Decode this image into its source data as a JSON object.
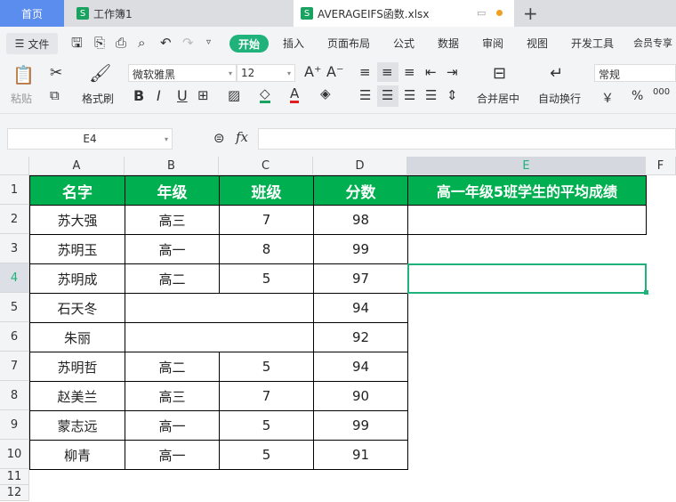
{
  "tabs": [
    {
      "label": "首页",
      "active": false
    },
    {
      "label": "工作簿1"
    },
    {
      "label": "AVERAGEIFS函数.xlsx"
    }
  ],
  "new_tab": "+",
  "menu": {
    "file": "文件",
    "items": [
      "开始",
      "插入",
      "页面布局",
      "公式",
      "数据",
      "审阅",
      "视图",
      "开发工具",
      "会员专享"
    ]
  },
  "ribbon": {
    "paste": "粘贴",
    "format_painter": "格式刷",
    "font": "微软雅黑",
    "size": "12",
    "merge": "合并居中",
    "wrap": "自动换行",
    "number_format": "常规",
    "currency": "￥",
    "percent": "%",
    "thousands": "000"
  },
  "formula_bar": {
    "name_box": "E4",
    "fx": "fx",
    "value": ""
  },
  "columns": [
    "A",
    "B",
    "C",
    "D",
    "E",
    "F"
  ],
  "rows": [
    "1",
    "2",
    "3",
    "4",
    "5",
    "6",
    "7",
    "8",
    "9",
    "10",
    "11",
    "12"
  ],
  "header_row": [
    "名字",
    "年级",
    "班级",
    "分数",
    "高一年级5班学生的平均成绩"
  ],
  "data": [
    [
      "苏大强",
      "高三",
      "7",
      "98"
    ],
    [
      "苏明玉",
      "高一",
      "8",
      "99"
    ],
    [
      "苏明成",
      "高二",
      "5",
      "97"
    ],
    [
      "石天冬",
      "",
      "",
      "94"
    ],
    [
      "朱丽",
      "",
      "",
      "92"
    ],
    [
      "苏明哲",
      "高二",
      "5",
      "94"
    ],
    [
      "赵美兰",
      "高三",
      "7",
      "90"
    ],
    [
      "蒙志远",
      "高一",
      "5",
      "99"
    ],
    [
      "柳青",
      "高一",
      "5",
      "91"
    ]
  ],
  "selected_cell": "E4",
  "colors": {
    "header_green": "#00b050",
    "accent": "#1fb27a",
    "home_tab": "#5b8def"
  }
}
